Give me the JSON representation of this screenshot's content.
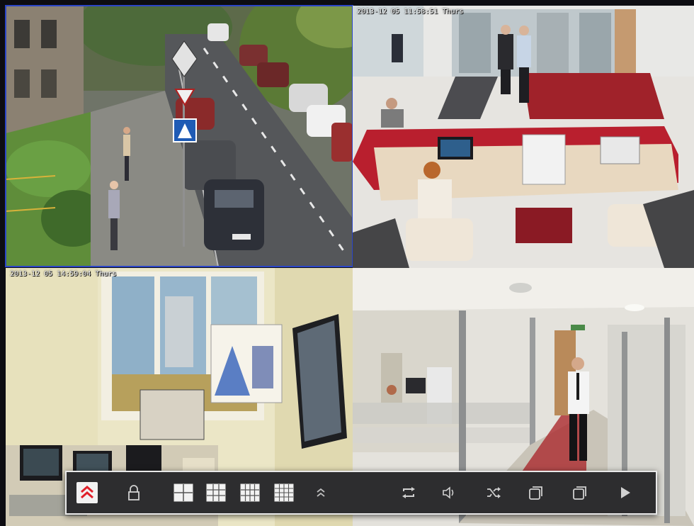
{
  "cameras": [
    {
      "id": "cam1",
      "name": "street-camera",
      "osd": ""
    },
    {
      "id": "cam2",
      "name": "reception-camera",
      "osd": "2013-12 05 11:58:51 Thurs"
    },
    {
      "id": "cam3",
      "name": "office-camera",
      "osd": "2013-12 05 14:59:04 Thurs"
    },
    {
      "id": "cam4",
      "name": "corridor-camera",
      "osd": ""
    }
  ],
  "toolbar": {
    "buttons": [
      {
        "name": "collapse-toolbar-button",
        "icon": "double-chevron-up-icon",
        "active": true,
        "accent": "#e0202a"
      },
      {
        "name": "lock-button",
        "icon": "lock-icon"
      },
      {
        "name": "layout-4-button",
        "icon": "grid-2x2-icon"
      },
      {
        "name": "layout-9-button",
        "icon": "grid-3x3-icon"
      },
      {
        "name": "layout-12-button",
        "icon": "grid-4x3-icon"
      },
      {
        "name": "layout-16-button",
        "icon": "grid-4x4-icon"
      },
      {
        "name": "more-layouts-button",
        "icon": "double-chevron-up-icon"
      },
      {
        "name": "sequence-button",
        "icon": "repeat-icon"
      },
      {
        "name": "volume-button",
        "icon": "speaker-icon"
      },
      {
        "name": "shuffle-button",
        "icon": "shuffle-icon"
      },
      {
        "name": "window-button",
        "icon": "stacked-windows-icon"
      },
      {
        "name": "window-alt-button",
        "icon": "stacked-windows-icon"
      },
      {
        "name": "play-button",
        "icon": "play-icon"
      }
    ]
  }
}
